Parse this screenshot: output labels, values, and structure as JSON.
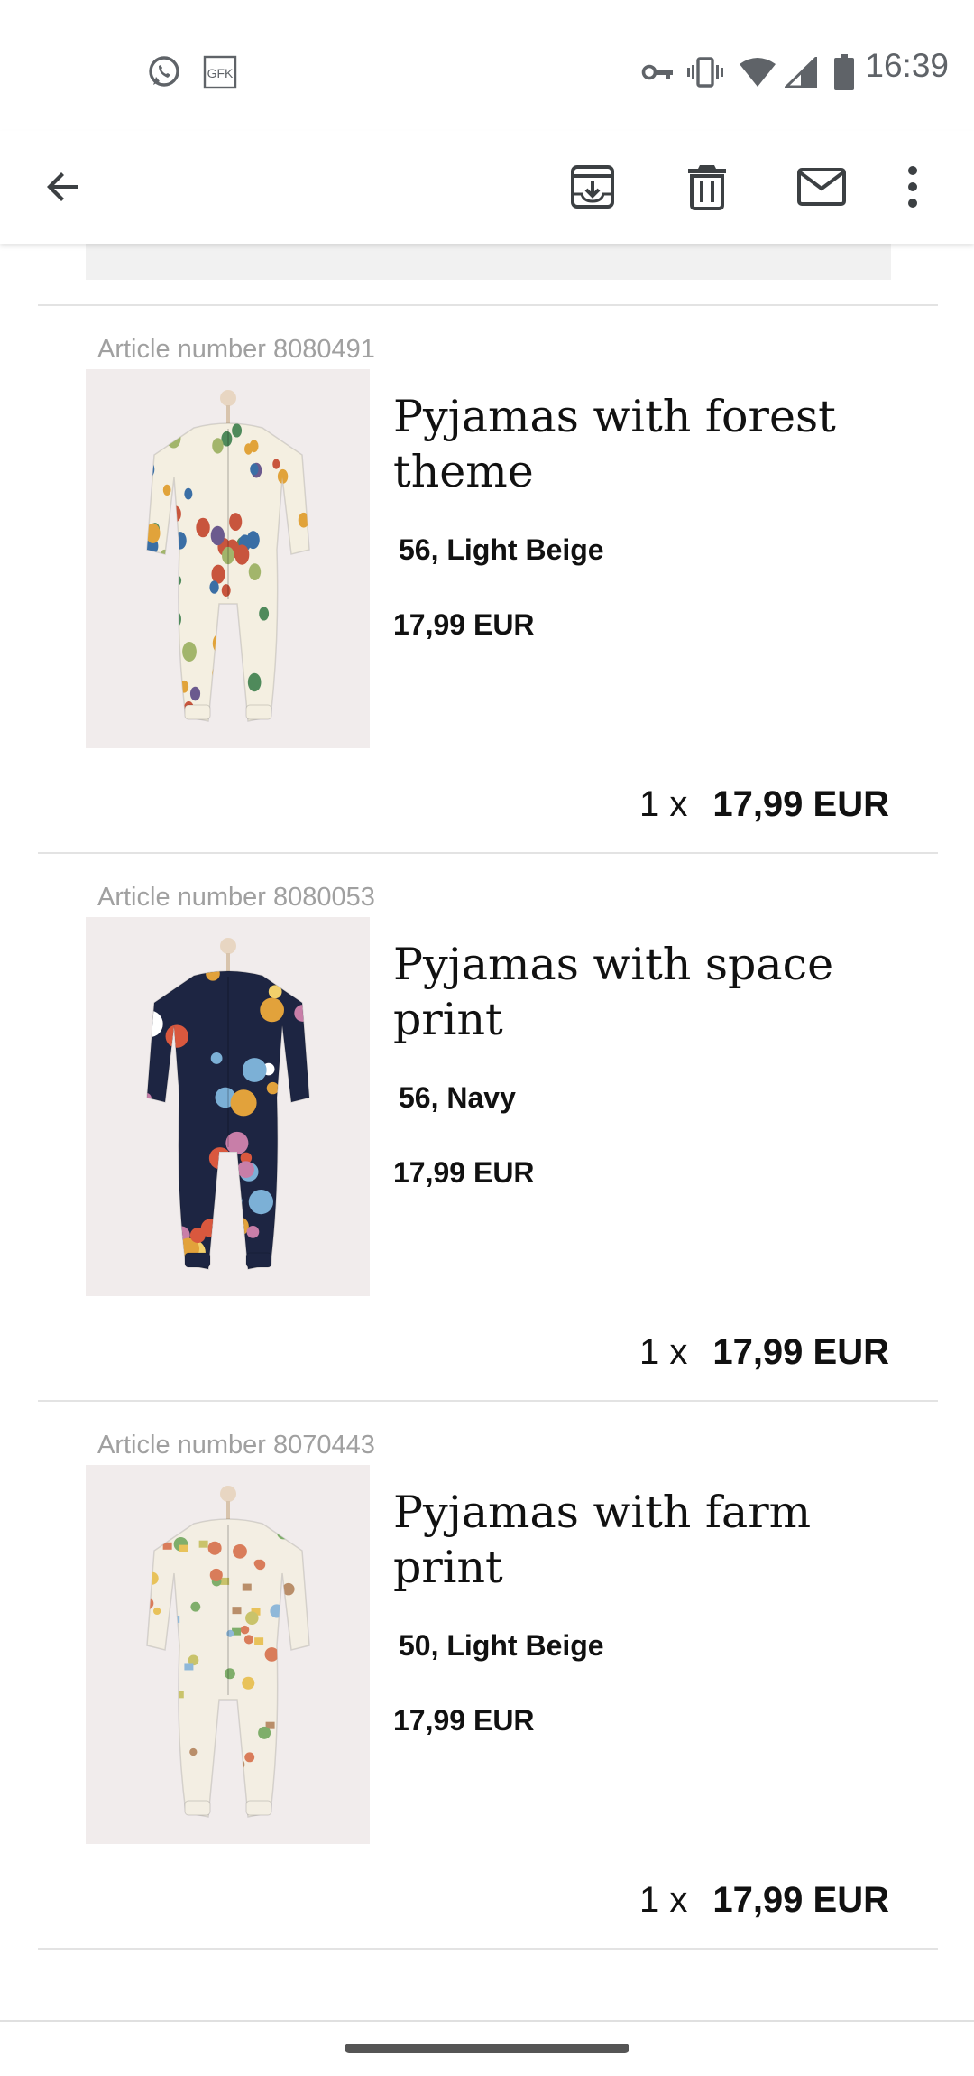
{
  "status_bar": {
    "time": "16:39",
    "left_icons": [
      "whatsapp-icon",
      "gfk-icon"
    ],
    "gfk_label": "GFK",
    "right_icons": [
      "vpn-key-icon",
      "vibrate-icon",
      "wifi-icon",
      "signal-icon",
      "battery-icon"
    ]
  },
  "app_bar": {
    "actions": [
      "back-arrow-icon",
      "archive-icon",
      "delete-icon",
      "mark-unread-icon",
      "more-vert-icon"
    ]
  },
  "products": [
    {
      "article_number": "Article number 8080491",
      "name": "Pyjamas with forest theme",
      "variant": "56, Light Beige",
      "unit_price": "17,99 EUR",
      "quantity": "1 x",
      "total": "17,99 EUR",
      "fabric_color": "#f4efe1",
      "pattern": "forest"
    },
    {
      "article_number": "Article number 8080053",
      "name": "Pyjamas with space print",
      "variant": "56, Navy",
      "unit_price": "17,99 EUR",
      "quantity": "1 x",
      "total": "17,99 EUR",
      "fabric_color": "#1d2542",
      "pattern": "space"
    },
    {
      "article_number": "Article number 8070443",
      "name": "Pyjamas with farm print",
      "variant": "50, Light Beige",
      "unit_price": "17,99 EUR",
      "quantity": "1 x",
      "total": "17,99 EUR",
      "fabric_color": "#f3eee3",
      "pattern": "farm"
    }
  ]
}
